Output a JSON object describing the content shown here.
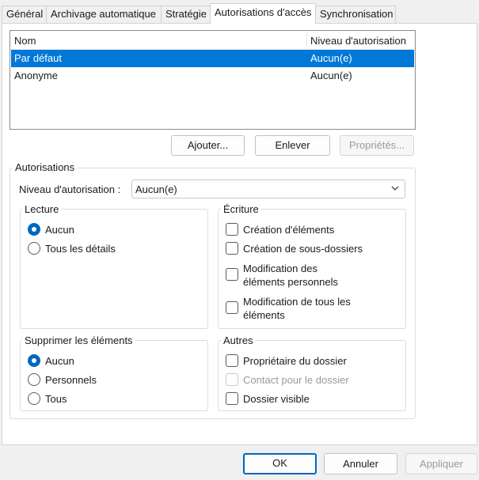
{
  "tabs": [
    "Général",
    "Archivage automatique",
    "Stratégie",
    "Autorisations d'accès",
    "Synchronisation"
  ],
  "list": {
    "columns": [
      "Nom",
      "Niveau d'autorisation"
    ],
    "rows": [
      {
        "name": "Par défaut",
        "level": "Aucun(e)",
        "selected": true
      },
      {
        "name": "Anonyme",
        "level": "Aucun(e)",
        "selected": false
      }
    ]
  },
  "list_buttons": {
    "add": "Ajouter...",
    "remove": "Enlever",
    "properties": "Propriétés..."
  },
  "permissions": {
    "title": "Autorisations",
    "level_label": "Niveau d'autorisation :",
    "level_value": "Aucun(e)",
    "read": {
      "title": "Lecture",
      "none": "Aucun",
      "full": "Tous les détails"
    },
    "write": {
      "title": "Écriture",
      "create_items": "Création d'éléments",
      "create_subfolders": "Création de sous-dossiers",
      "edit_own_1": "Modification des",
      "edit_own_2": "éléments personnels",
      "edit_all_1": "Modification de tous les",
      "edit_all_2": "éléments"
    },
    "delete": {
      "title": "Supprimer les éléments",
      "none": "Aucun",
      "own": "Personnels",
      "all": "Tous"
    },
    "other": {
      "title": "Autres",
      "owner": "Propriétaire du dossier",
      "contact": "Contact pour le dossier",
      "visible": "Dossier visible"
    }
  },
  "dialog_buttons": {
    "ok": "OK",
    "cancel": "Annuler",
    "apply": "Appliquer"
  },
  "colors": {
    "selection": "#0078d7",
    "accent": "#0067c0"
  }
}
